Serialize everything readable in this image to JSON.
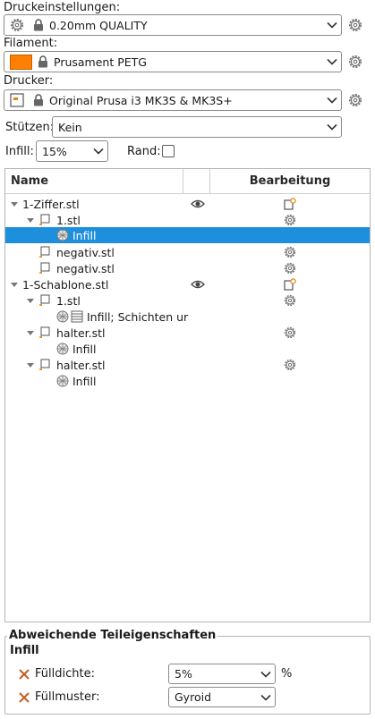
{
  "print_settings": {
    "label": "Druckeinstellungen:",
    "value": "0.20mm QUALITY"
  },
  "filament": {
    "label": "Filament:",
    "value": "Prusament PETG",
    "color": "#ff8000"
  },
  "printer": {
    "label": "Drucker:",
    "value": "Original Prusa i3 MK3S & MK3S+"
  },
  "supports": {
    "label": "Stützen:",
    "value": "Kein"
  },
  "infill": {
    "label": "Infill:",
    "value": "15%"
  },
  "brim": {
    "label": "Rand:",
    "checked": false
  },
  "tree": {
    "columns": [
      "Name",
      "",
      "Bearbeitung"
    ],
    "rows": [
      {
        "label": "1-Ziffer.stl"
      },
      {
        "label": "1.stl"
      },
      {
        "label": "Infill"
      },
      {
        "label": "negativ.stl"
      },
      {
        "label": "negativ.stl"
      },
      {
        "label": "1-Schablone.stl"
      },
      {
        "label": "1.stl"
      },
      {
        "label": "Infill; Schichten ur"
      },
      {
        "label": "halter.stl"
      },
      {
        "label": "Infill"
      },
      {
        "label": "halter.stl"
      },
      {
        "label": "Infill"
      }
    ]
  },
  "part_properties": {
    "title": "Abweichende Teileigenschaften",
    "section": "Infill",
    "density_label": "Fülldichte:",
    "density_value": "5%",
    "density_unit": "%",
    "pattern_label": "Füllmuster:",
    "pattern_value": "Gyroid"
  },
  "colors": {
    "selection": "#1e8fdc",
    "accent": "#ff8000",
    "delete_x": "#c75c26"
  }
}
